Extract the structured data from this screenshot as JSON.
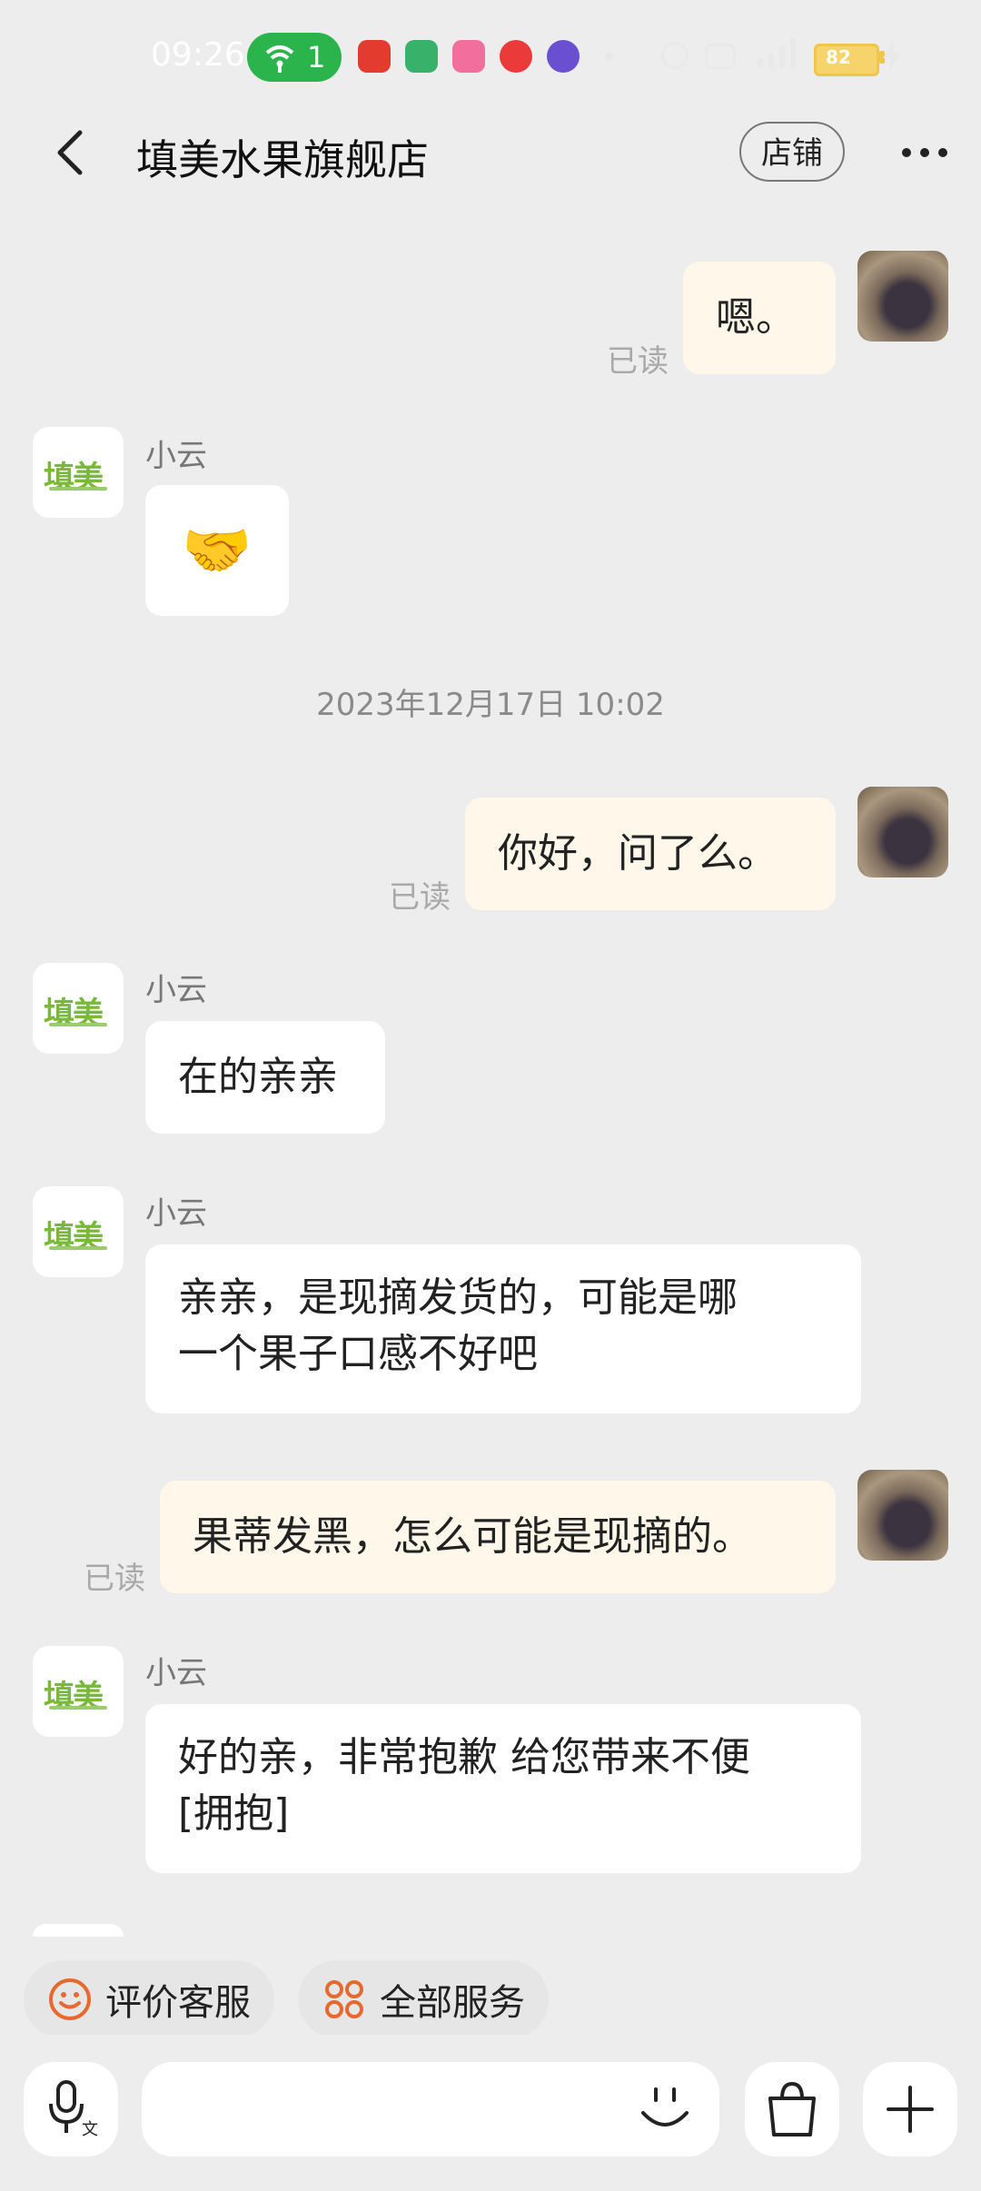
{
  "status_bar": {
    "time": "09:26",
    "wifi_count": "1",
    "battery": "82"
  },
  "header": {
    "title": "填美水果旗舰店",
    "shop_button": "店铺"
  },
  "messages": [
    {
      "from": "me",
      "text": "嗯。",
      "read": "已读"
    },
    {
      "from": "shop",
      "sender": "小云",
      "text": "🤝"
    },
    {
      "timestamp": "2023年12月17日 10:02"
    },
    {
      "from": "me",
      "text": "你好，问了么。",
      "read": "已读"
    },
    {
      "from": "shop",
      "sender": "小云",
      "text": "在的亲亲"
    },
    {
      "from": "shop",
      "sender": "小云",
      "text_line1": "亲亲，是现摘发货的，可能是哪",
      "text_line2": "一个果子口感不好吧"
    },
    {
      "from": "me",
      "text": "果蒂发黑，怎么可能是现摘的。",
      "read": "已读"
    },
    {
      "from": "shop",
      "sender": "小云",
      "text_line1": "好的亲，非常抱歉 给您带来不便",
      "text_line2": "[拥抱]"
    }
  ],
  "shop_logo_text": "填美",
  "quick_actions": {
    "rate": "评价客服",
    "all_services": "全部服务"
  },
  "colors": {
    "accent": "#e8692e",
    "wifi": "#2bb34c",
    "my_bubble": "#fff8ea"
  },
  "icons": {
    "back": "chevron-left-icon",
    "more": "more-dots-icon",
    "voice": "microphone-icon",
    "emoji": "smile-icon",
    "bag": "shopping-bag-icon",
    "plus": "plus-icon"
  }
}
